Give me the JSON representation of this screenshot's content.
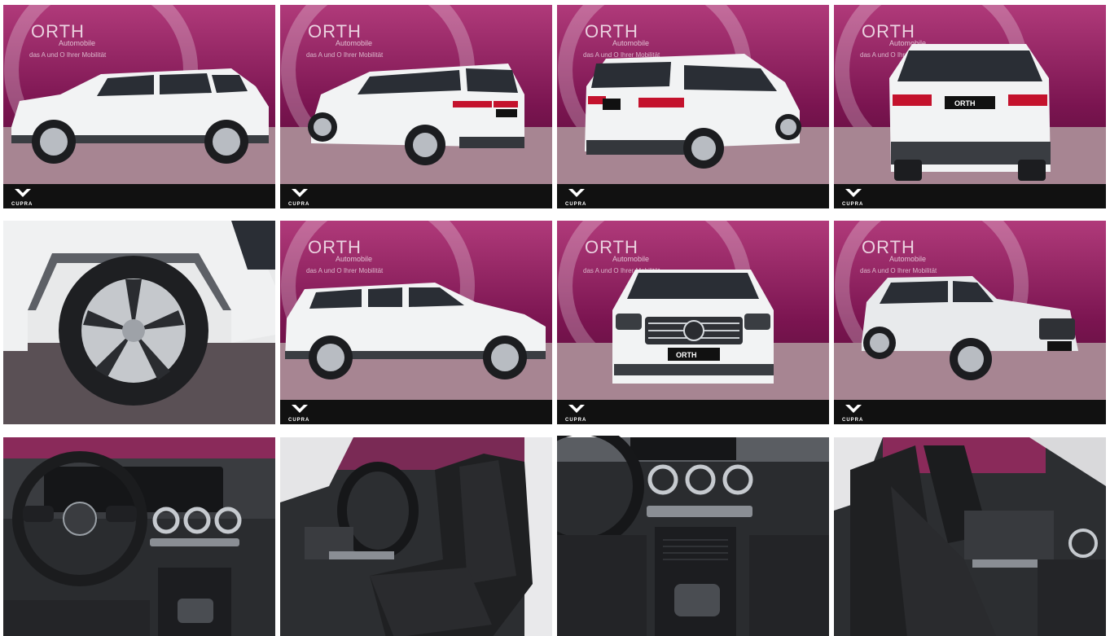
{
  "gallery": {
    "brand": {
      "name": "ORTH",
      "sub": "Automobile",
      "tagline": "das A und O Ihrer Mobilität"
    },
    "footer_brand": "CUPRA",
    "plate_text": "ORTH",
    "colors": {
      "backdrop_top": "#8a1a5a",
      "backdrop_bottom": "#3a0a28",
      "floor": "#b48a98",
      "car_white": "#f2f3f4",
      "interior_dark": "#2a2c2f",
      "footer_bar": "#111111"
    },
    "photos": [
      {
        "view": "side-left"
      },
      {
        "view": "rear-three-quarter-left"
      },
      {
        "view": "rear-three-quarter-right"
      },
      {
        "view": "rear"
      },
      {
        "view": "wheel-closeup"
      },
      {
        "view": "side-right"
      },
      {
        "view": "front"
      },
      {
        "view": "front-three-quarter-right"
      },
      {
        "view": "dashboard"
      },
      {
        "view": "driver-seat"
      },
      {
        "view": "center-console"
      },
      {
        "view": "passenger-seats"
      }
    ]
  }
}
